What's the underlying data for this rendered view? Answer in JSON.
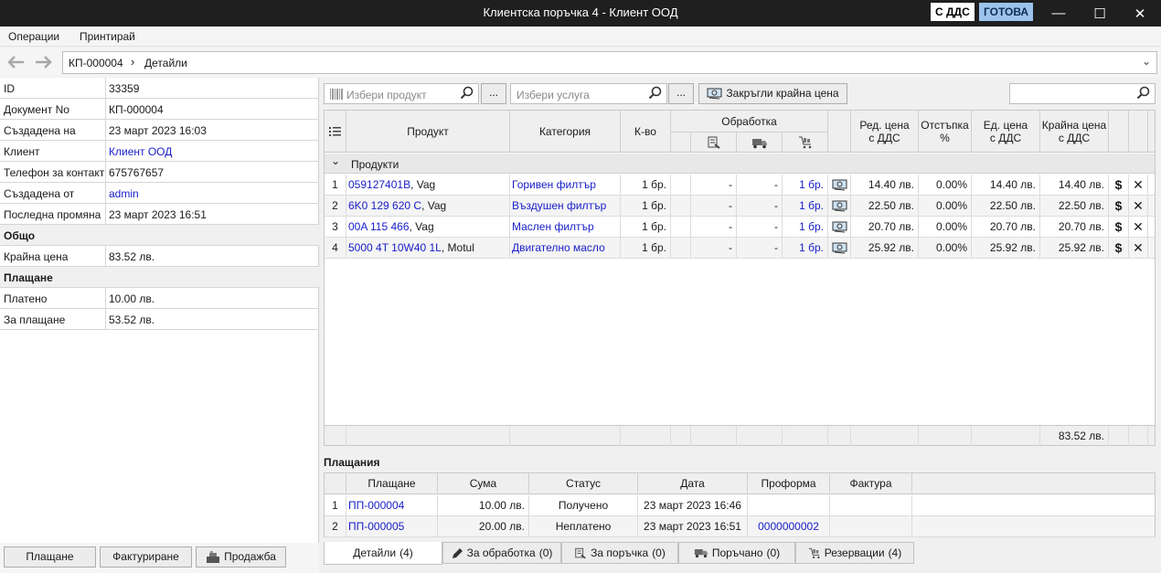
{
  "window": {
    "title": "Клиентска поръчка 4 - Клиент ООД",
    "vat_badge": "С ДДС",
    "status_badge": "ГОТОВА",
    "minimize": "—",
    "maximize": "☐",
    "close": "✕"
  },
  "menu": {
    "items": [
      "Операции",
      "Принтирай"
    ]
  },
  "breadcrumb": {
    "root": "КП-000004",
    "separator": "›",
    "current": "Детайли"
  },
  "details": {
    "rows": [
      {
        "key": "ID",
        "value": "33359"
      },
      {
        "key": "Документ No",
        "value": "КП-000004"
      },
      {
        "key": "Създадена на",
        "value": "23 март 2023 16:03"
      },
      {
        "key": "Клиент",
        "value": "Клиент ООД"
      },
      {
        "key": "Телефон за контакт",
        "value": "675767657"
      },
      {
        "key": "Създадена от",
        "value": "admin"
      },
      {
        "key": "Последна промяна",
        "value": "23 март 2023 16:51"
      }
    ],
    "section_total": "Общо",
    "total_key": "Крайна цена",
    "total_value": "83.52 лв.",
    "section_payment": "Плащане",
    "paid_key": "Платено",
    "paid_value": "10.00 лв.",
    "due_key": "За плащане",
    "due_value": "53.52 лв."
  },
  "left_buttons": {
    "payment": "Плащане",
    "invoicing": "Фактуриране",
    "sale": "Продажба"
  },
  "toolbar": {
    "product_placeholder": "Избери продукт",
    "service_placeholder": "Избери услуга",
    "dots": "...",
    "round_button": "Закръгли крайна цена"
  },
  "products": {
    "headers": {
      "product": "Продукт",
      "category": "Категория",
      "qty": "К-во",
      "processing": "Обработка",
      "row_price": [
        "Ред. цена",
        "с ДДС"
      ],
      "discount": [
        "Отстъпка",
        "%"
      ],
      "unit_price": [
        "Ед. цена",
        "с ДДС"
      ],
      "final_price": [
        "Крайна цена",
        "с ДДС"
      ]
    },
    "group_label": "Продукти",
    "group_toggle": "⌄",
    "rows": [
      {
        "n": "1",
        "code": "059127401B",
        "brand": ", Vag",
        "category": "Горивен филтър",
        "qty": "1 бр.",
        "p1": "-",
        "p2": "-",
        "p3": "1 бр.",
        "row_price": "14.40 лв.",
        "discount": "0.00%",
        "unit_price": "14.40 лв.",
        "final": "14.40 лв."
      },
      {
        "n": "2",
        "code": "6K0 129 620 C",
        "brand": ", Vag",
        "category": "Въздушен филтър",
        "qty": "1 бр.",
        "p1": "-",
        "p2": "-",
        "p3": "1 бр.",
        "row_price": "22.50 лв.",
        "discount": "0.00%",
        "unit_price": "22.50 лв.",
        "final": "22.50 лв."
      },
      {
        "n": "3",
        "code": "00A 115 466",
        "brand": ", Vag",
        "category": "Маслен филтър",
        "qty": "1 бр.",
        "p1": "-",
        "p2": "-",
        "p3": "1 бр.",
        "row_price": "20.70 лв.",
        "discount": "0.00%",
        "unit_price": "20.70 лв.",
        "final": "20.70 лв."
      },
      {
        "n": "4",
        "code": "5000 4T 10W40 1L",
        "brand": ", Motul",
        "category": "Двигателно масло",
        "qty": "1 бр.",
        "p1": "-",
        "p2": "-",
        "p3": "1 бр.",
        "row_price": "25.92 лв.",
        "discount": "0.00%",
        "unit_price": "25.92 лв.",
        "final": "25.92 лв."
      }
    ],
    "dollar": "$",
    "remove": "✕",
    "total": "83.52 лв."
  },
  "payments": {
    "label": "Плащания",
    "headers": [
      "Плащане",
      "Сума",
      "Статус",
      "Дата",
      "Проформа",
      "Фактура"
    ],
    "rows": [
      {
        "n": "1",
        "doc": "ПП-000004",
        "amount": "10.00 лв.",
        "status": "Получено",
        "date": "23 март 2023 16:46",
        "proforma": "",
        "invoice": ""
      },
      {
        "n": "2",
        "doc": "ПП-000005",
        "amount": "20.00 лв.",
        "status": "Неплатено",
        "date": "23 март 2023 16:51",
        "proforma": "0000000002",
        "invoice": ""
      }
    ]
  },
  "tabs": [
    {
      "label": "Детайли",
      "count": "(4)"
    },
    {
      "label": "За обработка",
      "count": "(0)"
    },
    {
      "label": "За поръчка",
      "count": "(0)"
    },
    {
      "label": "Поръчано",
      "count": "(0)"
    },
    {
      "label": "Резервации",
      "count": "(4)"
    }
  ],
  "colors": {
    "link": "#1a20c8",
    "titlebar": "#1f1f1f",
    "ready_badge": "#9cc3ec"
  }
}
